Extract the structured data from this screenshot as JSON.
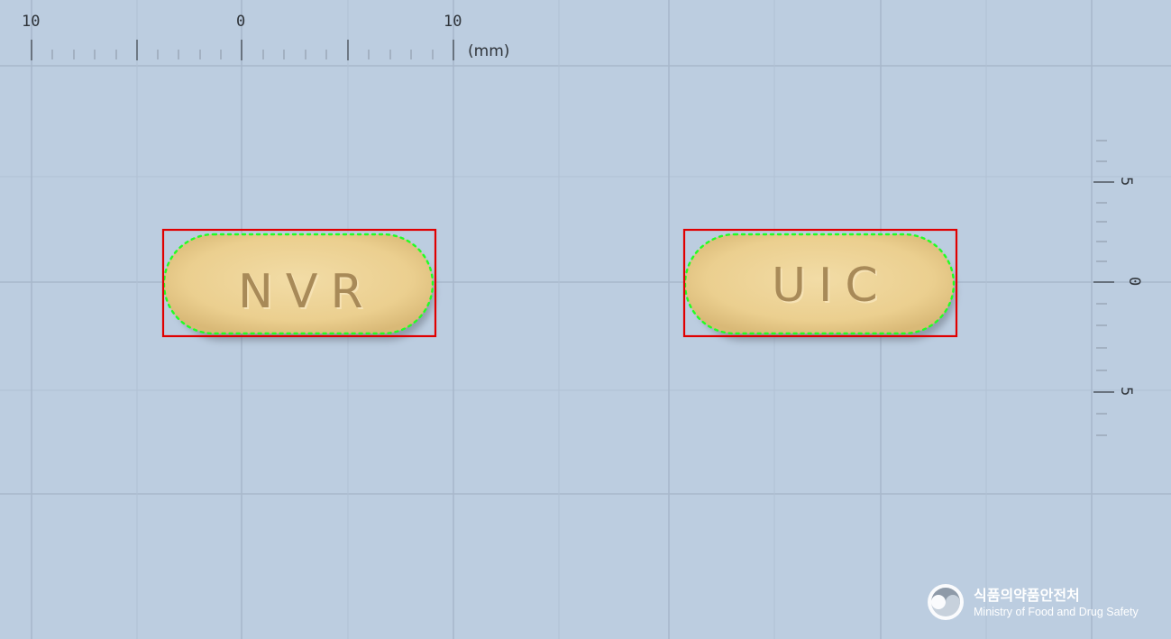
{
  "ruler_top": {
    "labels": [
      "10",
      "0",
      "10"
    ],
    "unit": "(mm)"
  },
  "ruler_right": {
    "labels": [
      "5",
      "0",
      "5"
    ]
  },
  "pills": [
    {
      "imprint": "NVR",
      "color": "#ecd192"
    },
    {
      "imprint": "UIC",
      "color": "#ecd192"
    }
  ],
  "logo": {
    "korean": "식품의약품안전처",
    "english": "Ministry of Food and Drug Safety"
  },
  "colors": {
    "background": "#bccde0",
    "bounding_box": "#e00000",
    "contour": "#22ff22"
  }
}
